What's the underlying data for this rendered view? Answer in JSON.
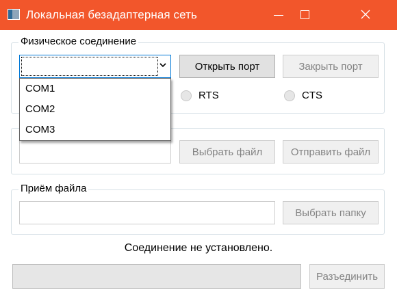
{
  "window": {
    "title": "Локальная безадаптерная сеть",
    "icon": "app-window-icon"
  },
  "physical": {
    "legend": "Физическое соединение",
    "port_value": "",
    "port_options": [
      "COM1",
      "COM2",
      "COM3"
    ],
    "open_label": "Открыть порт",
    "close_label": "Закрыть порт",
    "rts_label": "RTS",
    "cts_label": "CTS"
  },
  "send": {
    "legend": "",
    "file_value": "",
    "choose_label": "Выбрать файл",
    "send_label": "Отправить файл"
  },
  "receive": {
    "legend": "Приём файла",
    "folder_value": "",
    "choose_folder_label": "Выбрать папку"
  },
  "status_text": "Соединение не установлено.",
  "progress": {
    "value": 0
  },
  "disconnect_label": "Разъединить",
  "colors": {
    "titlebar": "#f2562b",
    "focus": "#0078d7",
    "progress_fill": "#06b025"
  }
}
